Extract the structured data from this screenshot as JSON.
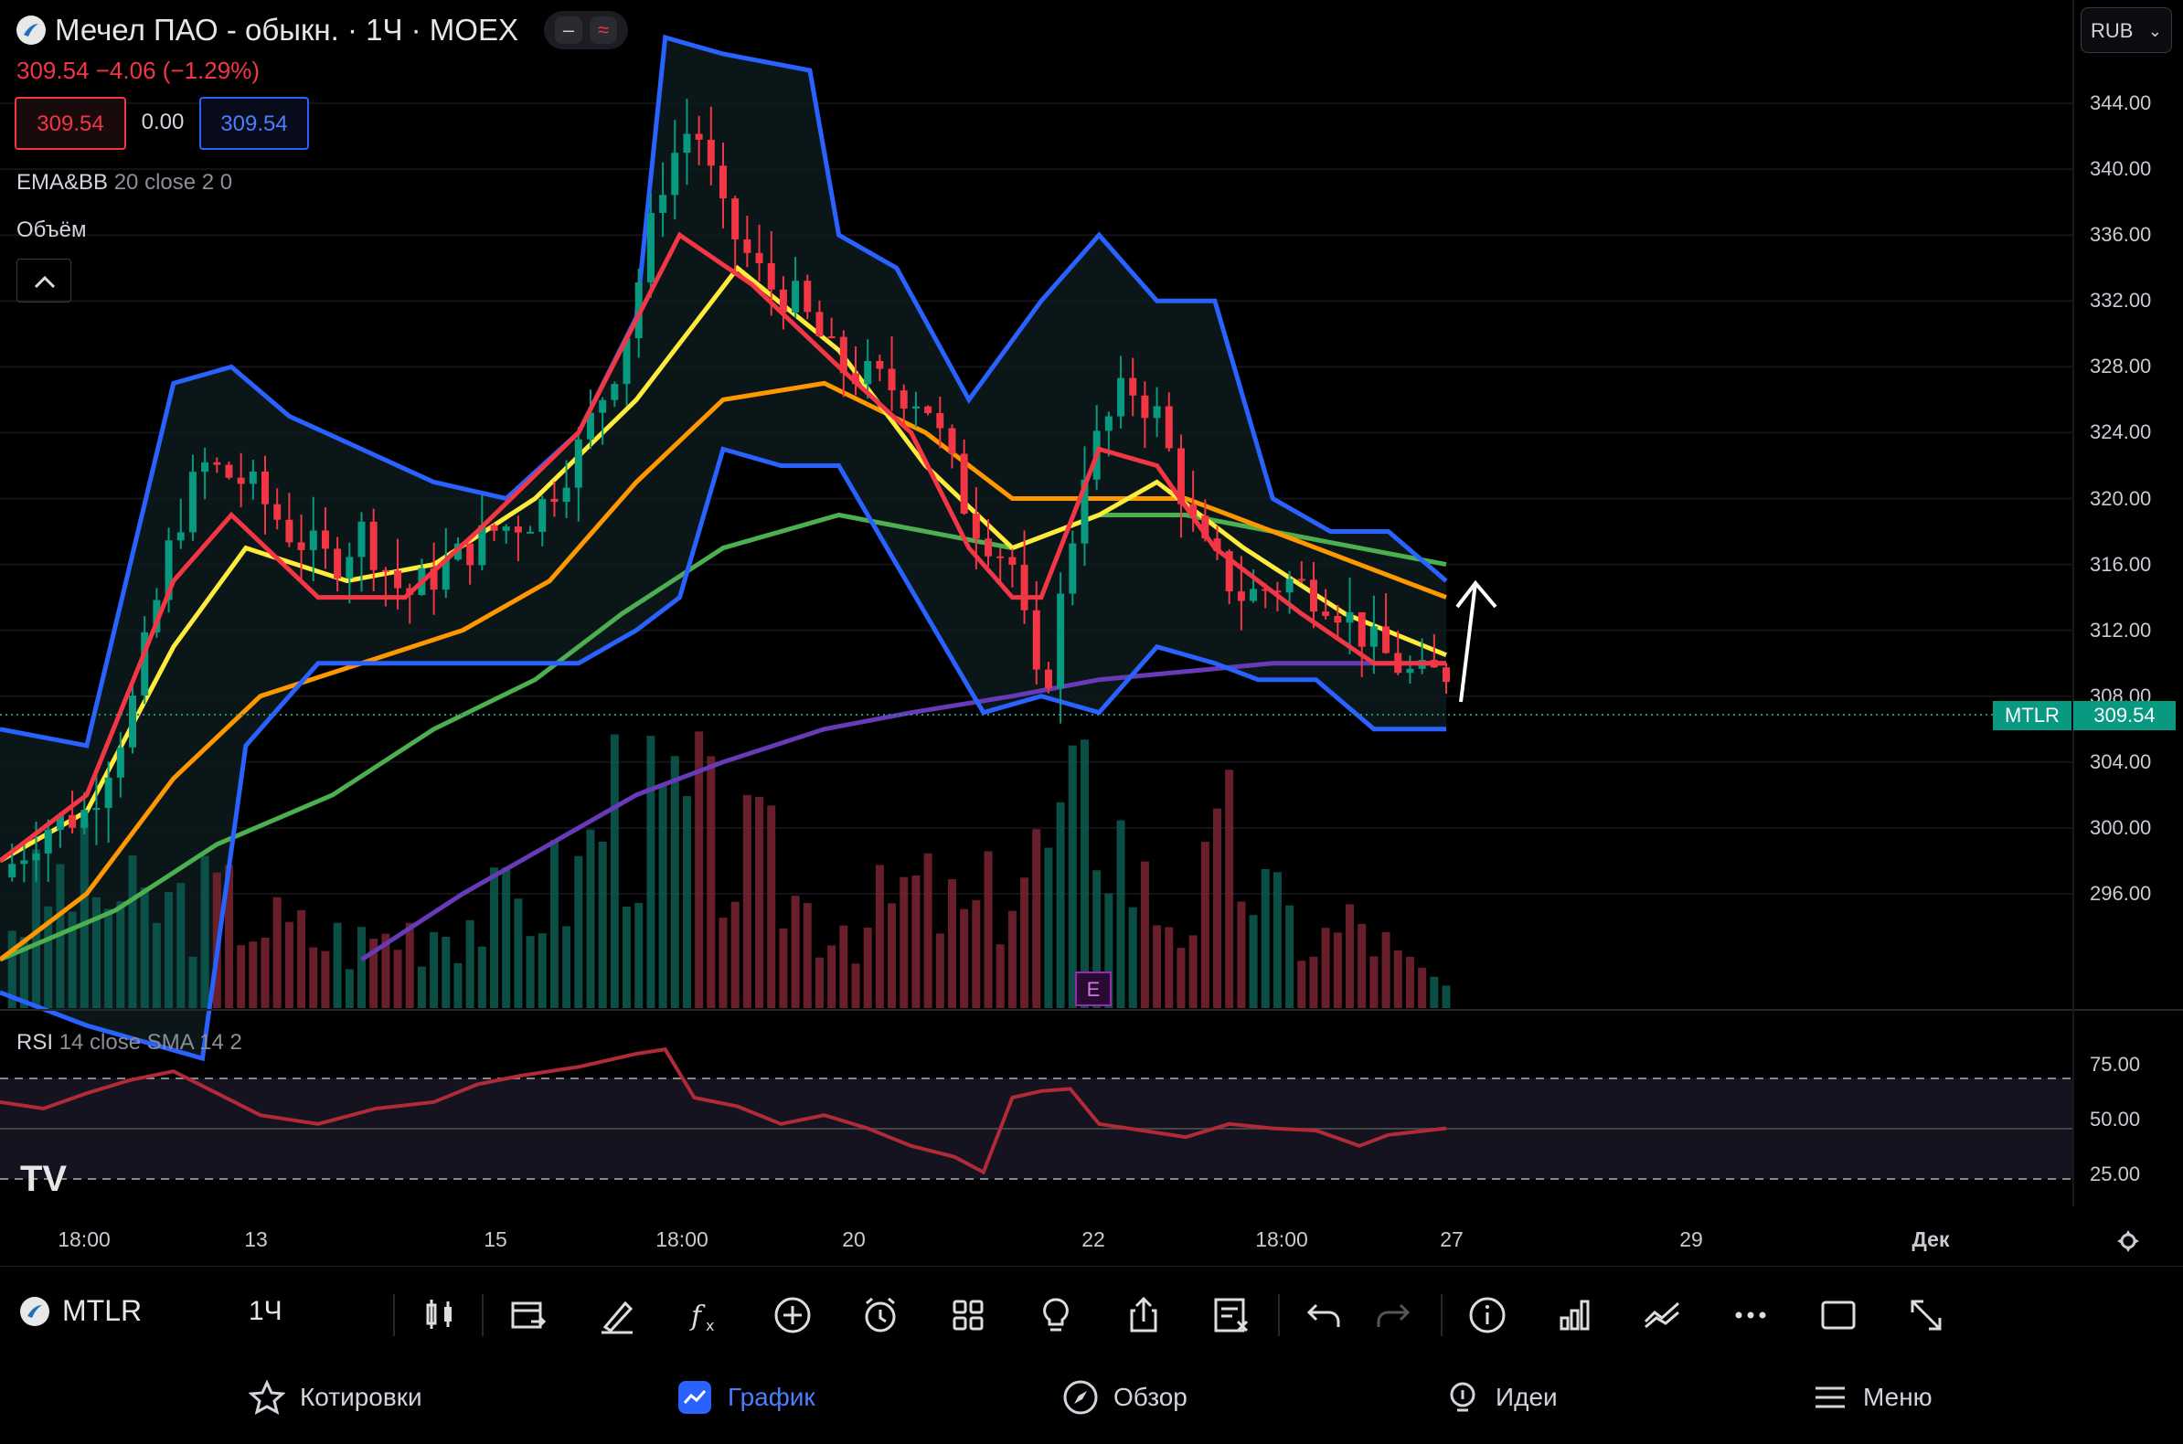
{
  "header": {
    "title": "Мечел ПАО - обыкн. · 1Ч · MOEX",
    "price_change": "309.54 −4.06 (−1.29%)",
    "bid": "309.54",
    "spread": "0.00",
    "ask": "309.54",
    "currency": "RUB"
  },
  "indicators": {
    "ema_bb_name": "EMA&BB",
    "ema_bb_params": "20 close 2 0",
    "volume_label": "Объём",
    "rsi_name": "RSI",
    "rsi_params": "14 close SMA 14 2"
  },
  "price_scale": {
    "ticks": [
      "344.00",
      "340.00",
      "336.00",
      "332.00",
      "328.00",
      "324.00",
      "320.00",
      "316.00",
      "312.00",
      "308.00",
      "304.00",
      "300.00",
      "296.00"
    ],
    "symbol_tag": "MTLR",
    "last_price_tag": "309.54"
  },
  "rsi_scale": {
    "ticks": [
      "75.00",
      "50.00",
      "25.00"
    ]
  },
  "time_axis": {
    "ticks": [
      "18:00",
      "13",
      "15",
      "18:00",
      "20",
      "22",
      "18:00",
      "27",
      "29",
      "Дек"
    ]
  },
  "earnings_marker": "E",
  "chart_data": {
    "type": "candlestick",
    "symbol": "MTLR",
    "interval": "1H",
    "exchange": "MOEX",
    "last": 309.54,
    "change": -4.06,
    "change_pct": -1.29,
    "y_range": [
      292,
      348
    ],
    "rsi_range": [
      0,
      100
    ],
    "rsi_levels": [
      70,
      30
    ],
    "price_path": [
      [
        0,
        297
      ],
      [
        3,
        300
      ],
      [
        6,
        301
      ],
      [
        9,
        307
      ],
      [
        12,
        318
      ],
      [
        14,
        322
      ],
      [
        17,
        321
      ],
      [
        20,
        318
      ],
      [
        23,
        316
      ],
      [
        25,
        318
      ],
      [
        28,
        314
      ],
      [
        31,
        316
      ],
      [
        34,
        318
      ],
      [
        37,
        319
      ],
      [
        40,
        323
      ],
      [
        43,
        329
      ],
      [
        46,
        340
      ],
      [
        48,
        343
      ],
      [
        50,
        337
      ],
      [
        53,
        333
      ],
      [
        55,
        332
      ],
      [
        58,
        328
      ],
      [
        61,
        327
      ],
      [
        64,
        326
      ],
      [
        67,
        319
      ],
      [
        70,
        316
      ],
      [
        72,
        307
      ],
      [
        75,
        322
      ],
      [
        78,
        327
      ],
      [
        80,
        325
      ],
      [
        83,
        317
      ],
      [
        86,
        314
      ],
      [
        89,
        315
      ],
      [
        92,
        314
      ],
      [
        95,
        311
      ],
      [
        98,
        309
      ],
      [
        100,
        309.5
      ]
    ],
    "ema_red": [
      [
        0,
        298
      ],
      [
        6,
        302
      ],
      [
        12,
        315
      ],
      [
        16,
        319
      ],
      [
        22,
        314
      ],
      [
        28,
        314
      ],
      [
        33,
        318
      ],
      [
        40,
        324
      ],
      [
        47,
        336
      ],
      [
        52,
        333
      ],
      [
        58,
        328
      ],
      [
        63,
        324
      ],
      [
        67,
        317
      ],
      [
        70,
        314
      ],
      [
        72,
        314
      ],
      [
        76,
        323
      ],
      [
        80,
        322
      ],
      [
        84,
        317
      ],
      [
        90,
        313
      ],
      [
        95,
        310
      ],
      [
        100,
        310
      ]
    ],
    "ema_yellow": [
      [
        0,
        298
      ],
      [
        6,
        301
      ],
      [
        12,
        311
      ],
      [
        17,
        317
      ],
      [
        24,
        315
      ],
      [
        30,
        316
      ],
      [
        37,
        320
      ],
      [
        44,
        326
      ],
      [
        51,
        334
      ],
      [
        58,
        329
      ],
      [
        64,
        322
      ],
      [
        70,
        317
      ],
      [
        76,
        319
      ],
      [
        80,
        321
      ],
      [
        86,
        317
      ],
      [
        93,
        313
      ],
      [
        100,
        310.5
      ]
    ],
    "ema_orange": [
      [
        0,
        292
      ],
      [
        6,
        296
      ],
      [
        12,
        303
      ],
      [
        18,
        308
      ],
      [
        25,
        310
      ],
      [
        32,
        312
      ],
      [
        38,
        315
      ],
      [
        44,
        321
      ],
      [
        50,
        326
      ],
      [
        57,
        327
      ],
      [
        64,
        324
      ],
      [
        70,
        320
      ],
      [
        76,
        320
      ],
      [
        82,
        320
      ],
      [
        88,
        318
      ],
      [
        94,
        316
      ],
      [
        100,
        314
      ]
    ],
    "ma_green": [
      [
        0,
        292
      ],
      [
        8,
        295
      ],
      [
        15,
        299
      ],
      [
        23,
        302
      ],
      [
        30,
        306
      ],
      [
        37,
        309
      ],
      [
        43,
        313
      ],
      [
        50,
        317
      ],
      [
        58,
        319
      ],
      [
        64,
        318
      ],
      [
        70,
        317
      ],
      [
        76,
        319
      ],
      [
        82,
        319
      ],
      [
        88,
        318
      ],
      [
        94,
        317
      ],
      [
        100,
        316
      ]
    ],
    "ma_purple": [
      [
        25,
        292
      ],
      [
        32,
        296
      ],
      [
        38,
        299
      ],
      [
        44,
        302
      ],
      [
        50,
        304
      ],
      [
        57,
        306
      ],
      [
        63,
        307
      ],
      [
        70,
        308
      ],
      [
        76,
        309
      ],
      [
        82,
        309.5
      ],
      [
        88,
        310
      ],
      [
        94,
        310
      ],
      [
        100,
        310
      ]
    ],
    "bb_upper": [
      [
        0,
        306
      ],
      [
        6,
        305
      ],
      [
        12,
        327
      ],
      [
        16,
        328
      ],
      [
        20,
        325
      ],
      [
        25,
        323
      ],
      [
        30,
        321
      ],
      [
        35,
        320
      ],
      [
        40,
        324
      ],
      [
        44,
        331
      ],
      [
        46,
        348
      ],
      [
        50,
        347
      ],
      [
        56,
        346
      ],
      [
        58,
        336
      ],
      [
        62,
        334
      ],
      [
        67,
        326
      ],
      [
        72,
        332
      ],
      [
        76,
        336
      ],
      [
        80,
        332
      ],
      [
        84,
        332
      ],
      [
        88,
        320
      ],
      [
        92,
        318
      ],
      [
        96,
        318
      ],
      [
        100,
        315
      ]
    ],
    "bb_lower": [
      [
        0,
        290
      ],
      [
        6,
        288
      ],
      [
        14,
        286
      ],
      [
        17,
        305
      ],
      [
        22,
        310
      ],
      [
        26,
        310
      ],
      [
        31,
        310
      ],
      [
        36,
        310
      ],
      [
        40,
        310
      ],
      [
        44,
        312
      ],
      [
        47,
        314
      ],
      [
        50,
        323
      ],
      [
        54,
        322
      ],
      [
        58,
        322
      ],
      [
        62,
        316
      ],
      [
        66,
        310
      ],
      [
        68,
        307
      ],
      [
        72,
        308
      ],
      [
        76,
        307
      ],
      [
        80,
        311
      ],
      [
        84,
        310
      ],
      [
        87,
        309
      ],
      [
        91,
        309
      ],
      [
        95,
        306
      ],
      [
        100,
        306
      ]
    ],
    "volume": [
      [
        0,
        40
      ],
      [
        5,
        60
      ],
      [
        10,
        45
      ],
      [
        15,
        50
      ],
      [
        20,
        35
      ],
      [
        25,
        30
      ],
      [
        30,
        40
      ],
      [
        35,
        45
      ],
      [
        40,
        60
      ],
      [
        42,
        100
      ],
      [
        45,
        85
      ],
      [
        48,
        90
      ],
      [
        50,
        70
      ],
      [
        53,
        65
      ],
      [
        56,
        45
      ],
      [
        60,
        40
      ],
      [
        63,
        55
      ],
      [
        67,
        40
      ],
      [
        70,
        60
      ],
      [
        73,
        75
      ],
      [
        76,
        100
      ],
      [
        79,
        55
      ],
      [
        82,
        40
      ],
      [
        85,
        75
      ],
      [
        88,
        45
      ],
      [
        91,
        30
      ],
      [
        94,
        40
      ],
      [
        97,
        20
      ],
      [
        100,
        10
      ]
    ],
    "rsi": [
      [
        0,
        58
      ],
      [
        3,
        55
      ],
      [
        6,
        62
      ],
      [
        9,
        68
      ],
      [
        12,
        72
      ],
      [
        15,
        62
      ],
      [
        18,
        52
      ],
      [
        22,
        48
      ],
      [
        26,
        55
      ],
      [
        30,
        58
      ],
      [
        33,
        66
      ],
      [
        36,
        70
      ],
      [
        40,
        74
      ],
      [
        44,
        80
      ],
      [
        46,
        82
      ],
      [
        48,
        60
      ],
      [
        51,
        56
      ],
      [
        54,
        48
      ],
      [
        57,
        52
      ],
      [
        60,
        46
      ],
      [
        63,
        38
      ],
      [
        66,
        33
      ],
      [
        68,
        26
      ],
      [
        70,
        60
      ],
      [
        72,
        63
      ],
      [
        74,
        64
      ],
      [
        76,
        48
      ],
      [
        79,
        45
      ],
      [
        82,
        42
      ],
      [
        85,
        48
      ],
      [
        88,
        46
      ],
      [
        91,
        45
      ],
      [
        94,
        38
      ],
      [
        96,
        43
      ],
      [
        100,
        46
      ]
    ]
  }
}
